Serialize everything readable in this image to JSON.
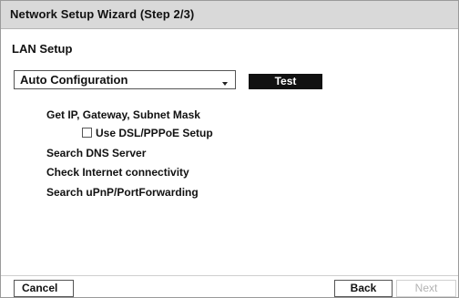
{
  "window": {
    "title": "Network Setup Wizard (Step 2/3)"
  },
  "section": {
    "label": "LAN Setup"
  },
  "config_select": {
    "value": "Auto Configuration",
    "icon": "dropdown-arrow-icon"
  },
  "test_button": {
    "label": "Test"
  },
  "steps": {
    "get_ip": "Get IP, Gateway, Subnet Mask",
    "use_dsl": {
      "label": "Use DSL/PPPoE Setup",
      "checked": false
    },
    "search_dns": "Search DNS Server",
    "check_internet": "Check Internet connectivity",
    "search_upnp": "Search uPnP/PortForwarding"
  },
  "footer": {
    "cancel_label": "Cancel",
    "back_label": "Back",
    "next_label": "Next",
    "next_enabled": false
  },
  "colors": {
    "titlebar_bg": "#d9d9d9",
    "test_button_bg": "#111111",
    "disabled_text": "#b3b3b3"
  }
}
